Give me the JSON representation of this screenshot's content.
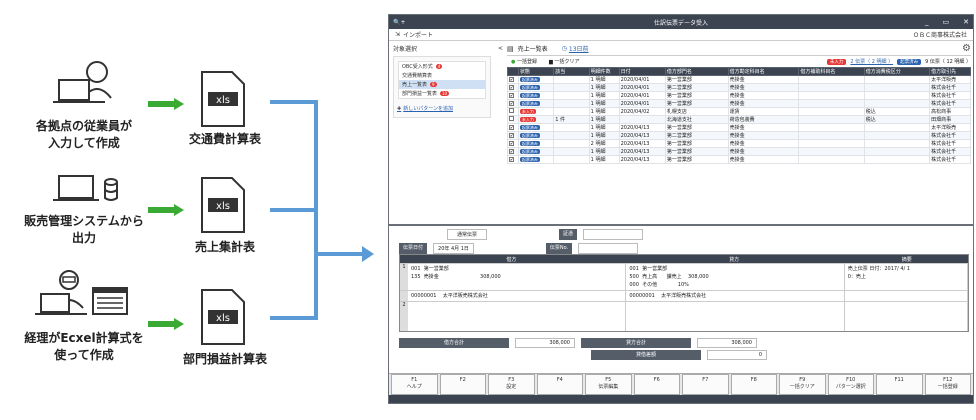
{
  "workflow": {
    "rows": [
      {
        "person_caption": "各拠点の従業員が\n入力して作成",
        "doc_caption": "交通費計算表",
        "file_ext": "xls"
      },
      {
        "person_caption": "販売管理システムから\n出力",
        "doc_caption": "売上集計表",
        "file_ext": "xls"
      },
      {
        "person_caption": "経理がEcxel計算式を\n使って作成",
        "doc_caption": "部門損益計算表",
        "file_ext": "xls"
      }
    ]
  },
  "app": {
    "title": "仕訳伝票データ受入",
    "menu_import": "インポート",
    "company": "ＯＢＣ商事株式会社",
    "window_controls": [
      "_",
      "▭",
      "✕"
    ],
    "sidebar": {
      "header": "対象選択",
      "collapse": "<",
      "items": [
        {
          "label": "OBC受入形式",
          "badge": "4",
          "selected": false
        },
        {
          "label": "交通費精算表",
          "badge": "",
          "selected": false
        },
        {
          "label": "売上一覧表",
          "badge": "9",
          "selected": true
        },
        {
          "label": "部門損益一覧表",
          "badge": "10",
          "selected": false
        }
      ],
      "add_pattern": "新しいパターンを追加"
    },
    "tab": "売上一覧表",
    "tab_date": "13日前",
    "toolbar": {
      "bulk_register": "一括登録",
      "bulk_clear": "一括クリア",
      "status_pending": "未入力",
      "pending_text": "2 伝票（ 2 明細 ）",
      "status_done": "起票済み",
      "done_text": "9 伝票（ 12 明細 ）"
    },
    "grid": {
      "columns": [
        "",
        "状態",
        "該当",
        "明細件数",
        "日付",
        "借方部門名",
        "借方勘定科目名",
        "借方補助科目名",
        "借方消費税区分",
        "借方取引先"
      ],
      "rows": [
        {
          "checked": "✔",
          "status": "起票済み",
          "status_color": "blue",
          "flag": "",
          "lines": "1 明細",
          "date": "2020/04/01",
          "dept": "第一営業部",
          "account": "売掛金",
          "sub": "",
          "tax": "",
          "partner": "太平洋販売"
        },
        {
          "checked": "✔",
          "status": "起票済み",
          "status_color": "blue",
          "flag": "",
          "lines": "1 明細",
          "date": "2020/04/01",
          "dept": "第二営業部",
          "account": "売掛金",
          "sub": "",
          "tax": "",
          "partner": "株式会社千"
        },
        {
          "checked": "✔",
          "status": "起票済み",
          "status_color": "blue",
          "flag": "",
          "lines": "1 明細",
          "date": "2020/04/01",
          "dept": "第一営業部",
          "account": "売掛金",
          "sub": "",
          "tax": "",
          "partner": "株式会社千"
        },
        {
          "checked": "✔",
          "status": "起票済み",
          "status_color": "blue",
          "flag": "",
          "lines": "1 明細",
          "date": "2020/04/01",
          "dept": "第一営業部",
          "account": "売掛金",
          "sub": "",
          "tax": "",
          "partner": "株式会社千"
        },
        {
          "checked": "",
          "status": "未入力",
          "status_color": "red",
          "flag": "",
          "lines": "1 明細",
          "date": "2020/04/02",
          "dept": "札幌支店",
          "account": "運賃",
          "sub": "",
          "tax": "税込",
          "partner": "高松商事"
        },
        {
          "checked": "",
          "status": "未入力",
          "status_color": "red",
          "flag": "1 件",
          "lines": "1 明細",
          "date": "",
          "dept": "北海道支社",
          "account": "荷造包装費",
          "sub": "",
          "tax": "税込",
          "partner": "田畑商事"
        },
        {
          "checked": "✔",
          "status": "起票済み",
          "status_color": "blue",
          "flag": "",
          "lines": "1 明細",
          "date": "2020/04/13",
          "dept": "第一営業部",
          "account": "売掛金",
          "sub": "",
          "tax": "",
          "partner": "太平洋販売"
        },
        {
          "checked": "✔",
          "status": "起票済み",
          "status_color": "blue",
          "flag": "",
          "lines": "1 明細",
          "date": "2020/04/13",
          "dept": "第二営業部",
          "account": "売掛金",
          "sub": "",
          "tax": "",
          "partner": "株式会社千"
        },
        {
          "checked": "✔",
          "status": "起票済み",
          "status_color": "blue",
          "flag": "",
          "lines": "2 明細",
          "date": "2020/04/13",
          "dept": "第一営業部",
          "account": "売掛金",
          "sub": "",
          "tax": "",
          "partner": "株式会社千"
        },
        {
          "checked": "✔",
          "status": "起票済み",
          "status_color": "blue",
          "flag": "",
          "lines": "1 明細",
          "date": "2020/04/13",
          "dept": "第一営業部",
          "account": "売掛金",
          "sub": "",
          "tax": "",
          "partner": "株式会社千"
        },
        {
          "checked": "✔",
          "status": "起票済み",
          "status_color": "blue",
          "flag": "",
          "lines": "1 明細",
          "date": "2020/04/13",
          "dept": "第一営業部",
          "account": "売掛金",
          "sub": "",
          "tax": "",
          "partner": "株式会社千"
        }
      ]
    },
    "detail": {
      "voucher_type_label": "通常伝票",
      "date_label": "伝票日付",
      "date_value": "20年 4月 1日",
      "summary_label": "証憑",
      "voucher_no_label": "伝票No.",
      "debit_header": "借方",
      "credit_header": "貸方",
      "memo_header": "摘要",
      "line1_debit": "001  第一営業部\n135  売掛金                          308,000\n",
      "line1_credit": "001  第一営業部\n500  売上高      課売上    308,000\n000  その他             10%",
      "line1_memo": "売上伝票 日付：2017/ 4/ 1\n0：売上",
      "line1_debit_partner": "00000001    太平洋販売株式会社",
      "line1_credit_partner": "00000001    太平洋販売株式会社",
      "line2_num": "2",
      "line1_num": "1",
      "debit_total_label": "借方合計",
      "debit_total": "308,000",
      "credit_total_label": "貸方合計",
      "credit_total": "308,000",
      "diff_label": "貸借差額",
      "diff_value": "0"
    },
    "fkeys": [
      {
        "key": "F1",
        "label": "ヘルプ"
      },
      {
        "key": "F2",
        "label": ""
      },
      {
        "key": "F3",
        "label": "設定"
      },
      {
        "key": "F4",
        "label": ""
      },
      {
        "key": "F5",
        "label": "伝票編集"
      },
      {
        "key": "F6",
        "label": ""
      },
      {
        "key": "F7",
        "label": ""
      },
      {
        "key": "F8",
        "label": ""
      },
      {
        "key": "F9",
        "label": "一括クリア"
      },
      {
        "key": "F10",
        "label": "パターン選択"
      },
      {
        "key": "F11",
        "label": ""
      },
      {
        "key": "F12",
        "label": "一括登録"
      }
    ]
  },
  "colors": {
    "arrow_green": "#3aaa35",
    "connector_blue": "#5b9bd5",
    "titlebar": "#3c4452"
  }
}
